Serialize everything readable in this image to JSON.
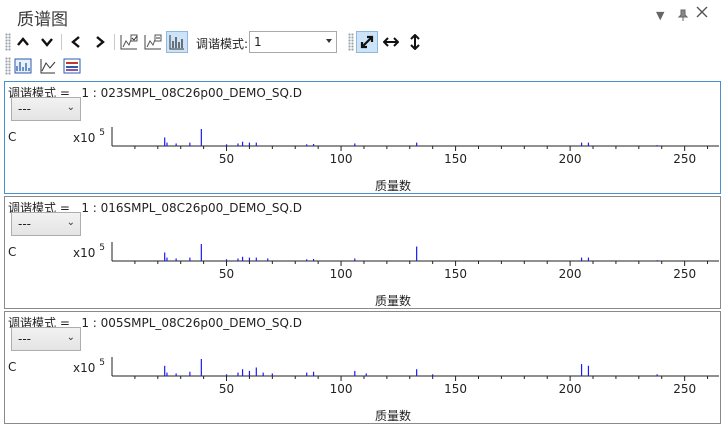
{
  "window": {
    "title": "质谱图"
  },
  "toolbar": {
    "tune_mode_label": "调谐模式:",
    "tune_mode_value": "1"
  },
  "panels": [
    {
      "header": "调谐模式 =   1 : 023SMPL_08C26p00_DEMO_SQ.D",
      "dropdown": "---",
      "c_label": "C",
      "exp_base": "x10",
      "exp_power": "5",
      "x_axis_label": "质量数"
    },
    {
      "header": "调谐模式 =   1 : 016SMPL_08C26p00_DEMO_SQ.D",
      "dropdown": "---",
      "c_label": "C",
      "exp_base": "x10",
      "exp_power": "5",
      "x_axis_label": "质量数"
    },
    {
      "header": "调谐模式 =   1 : 005SMPL_08C26p00_DEMO_SQ.D",
      "dropdown": "---",
      "c_label": "C",
      "exp_base": "x10",
      "exp_power": "5",
      "x_axis_label": "质量数"
    }
  ],
  "chart_data": [
    {
      "type": "bar",
      "xlim": [
        0,
        265
      ],
      "x_ticks": [
        50,
        100,
        150,
        200,
        250
      ],
      "xlabel": "质量数",
      "peaks": [
        [
          23,
          0.5
        ],
        [
          24,
          0.2
        ],
        [
          28,
          0.15
        ],
        [
          34,
          0.2
        ],
        [
          39,
          1.0
        ],
        [
          50,
          0.1
        ],
        [
          55,
          0.15
        ],
        [
          57,
          0.25
        ],
        [
          60,
          0.2
        ],
        [
          63,
          0.2
        ],
        [
          85,
          0.1
        ],
        [
          88,
          0.12
        ],
        [
          106,
          0.15
        ],
        [
          133,
          0.2
        ],
        [
          205,
          0.2
        ],
        [
          208,
          0.2
        ],
        [
          238,
          0.05
        ]
      ]
    },
    {
      "type": "bar",
      "xlim": [
        0,
        265
      ],
      "x_ticks": [
        50,
        100,
        150,
        200,
        250
      ],
      "xlabel": "质量数",
      "peaks": [
        [
          23,
          0.5
        ],
        [
          24,
          0.2
        ],
        [
          28,
          0.15
        ],
        [
          34,
          0.2
        ],
        [
          39,
          1.0
        ],
        [
          50,
          0.1
        ],
        [
          55,
          0.15
        ],
        [
          57,
          0.25
        ],
        [
          60,
          0.2
        ],
        [
          63,
          0.2
        ],
        [
          68,
          0.15
        ],
        [
          85,
          0.1
        ],
        [
          88,
          0.12
        ],
        [
          106,
          0.15
        ],
        [
          133,
          0.85
        ],
        [
          205,
          0.2
        ],
        [
          208,
          0.2
        ],
        [
          238,
          0.05
        ]
      ]
    },
    {
      "type": "bar",
      "xlim": [
        0,
        265
      ],
      "x_ticks": [
        50,
        100,
        150,
        200,
        250
      ],
      "xlabel": "质量数",
      "peaks": [
        [
          23,
          0.6
        ],
        [
          24,
          0.2
        ],
        [
          28,
          0.15
        ],
        [
          34,
          0.25
        ],
        [
          39,
          1.0
        ],
        [
          50,
          0.1
        ],
        [
          55,
          0.2
        ],
        [
          57,
          0.4
        ],
        [
          60,
          0.3
        ],
        [
          63,
          0.5
        ],
        [
          66,
          0.2
        ],
        [
          70,
          0.15
        ],
        [
          85,
          0.2
        ],
        [
          88,
          0.25
        ],
        [
          106,
          0.3
        ],
        [
          111,
          0.15
        ],
        [
          133,
          0.4
        ],
        [
          140,
          0.1
        ],
        [
          205,
          0.7
        ],
        [
          208,
          0.6
        ],
        [
          238,
          0.1
        ]
      ]
    }
  ]
}
